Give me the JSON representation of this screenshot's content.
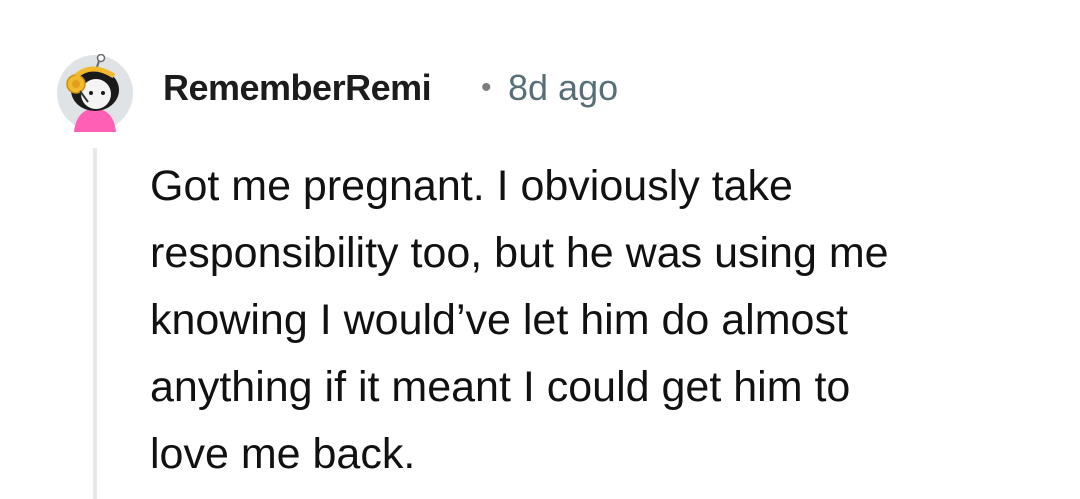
{
  "comment": {
    "author": "RememberRemi",
    "separator": "•",
    "timestamp": "8d ago",
    "avatar_icon": "cartoon-avatar-icon",
    "body_lines": [
      "Got me pregnant. I obviously take",
      "responsibility too, but he was using me",
      "knowing I would’ve let him do almost",
      "anything if it meant I could get him to",
      "love me back."
    ]
  },
  "colors": {
    "author": "#1c1c1c",
    "timestamp": "#576f76",
    "body_text": "#111111",
    "thread_line": "#e6e8ea",
    "avatar_bg": "#dfe3e6",
    "avatar_shirt": "#ff5fb5",
    "avatar_headphones": "#f2b92c"
  }
}
